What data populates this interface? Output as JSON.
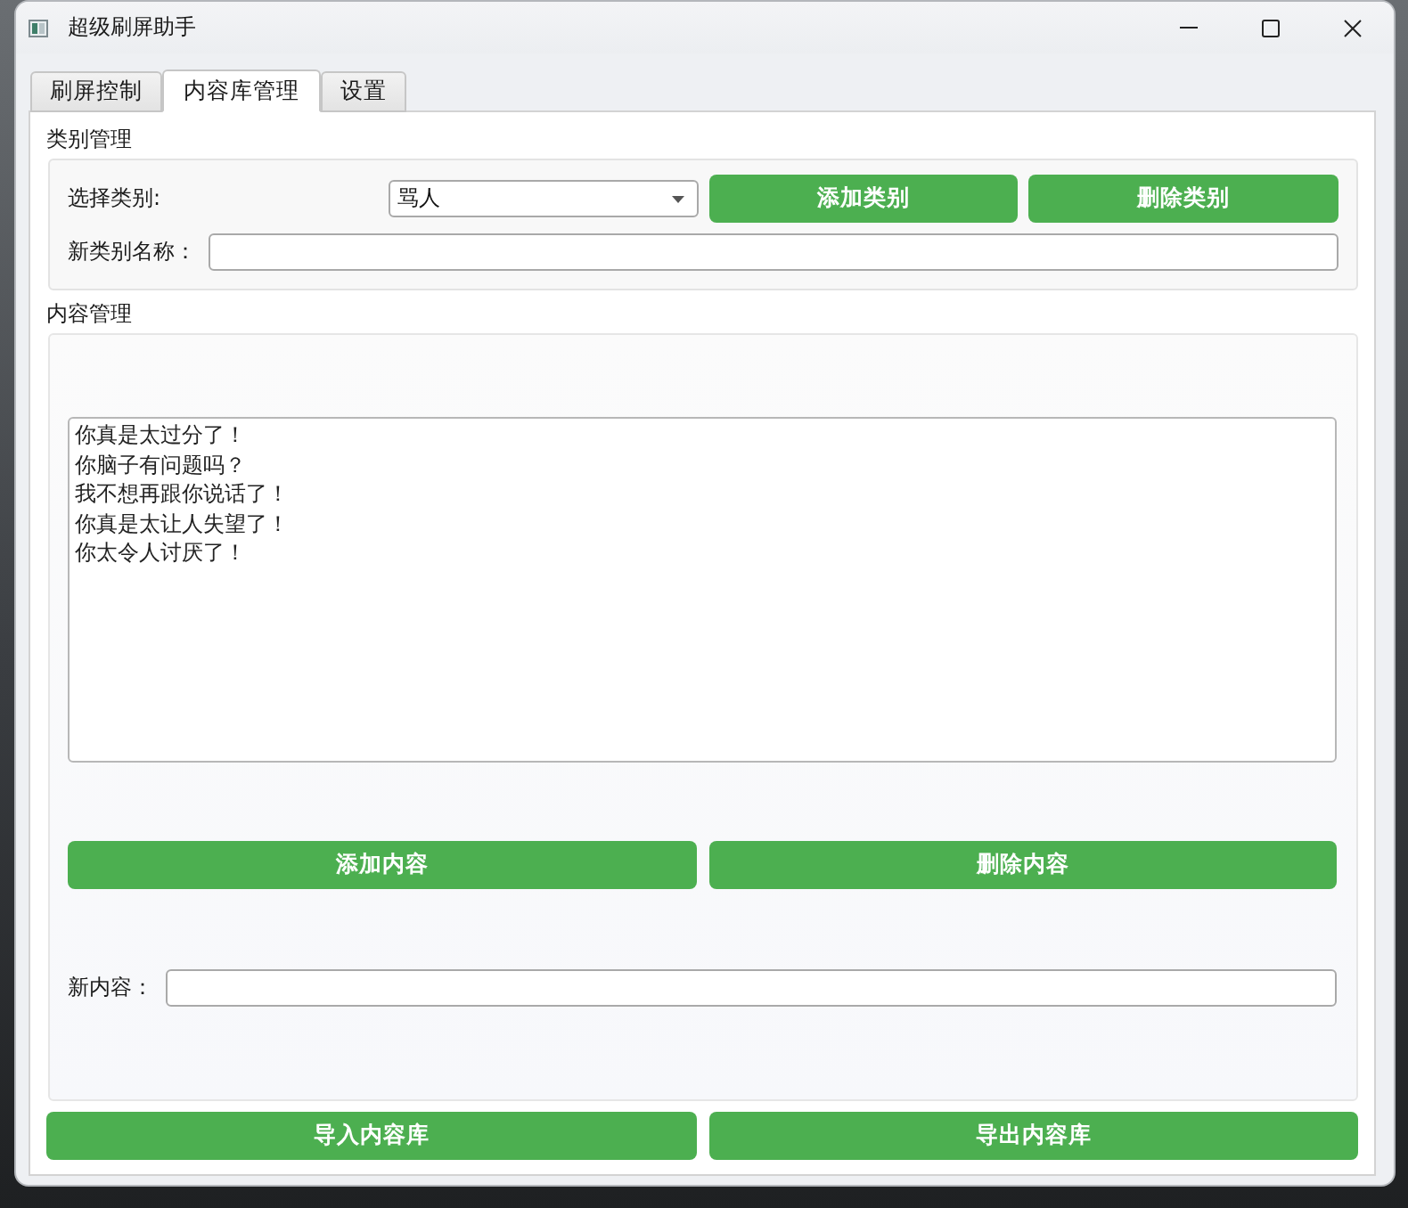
{
  "window": {
    "title": "超级刷屏助手"
  },
  "tabs": [
    {
      "label": "刷屏控制",
      "selected": false
    },
    {
      "label": "内容库管理",
      "selected": true
    },
    {
      "label": "设置",
      "selected": false
    }
  ],
  "category_management": {
    "title": "类别管理",
    "select_label": "选择类别:",
    "selected_category": "骂人",
    "buttons": [
      "添加类别",
      "删除类别"
    ],
    "new_name_label": "新类别名称："
  },
  "content_management": {
    "title": "内容管理",
    "items": [
      "你真是太过分了！",
      "你脑子有问题吗？",
      "我不想再跟你说话了！",
      "你真是太让人失望了！",
      "你太令人讨厌了！"
    ],
    "buttons": [
      "添加内容",
      "删除内容"
    ],
    "new_content_label": "新内容："
  },
  "library_buttons": [
    "导入内容库",
    "导出内容库"
  ]
}
